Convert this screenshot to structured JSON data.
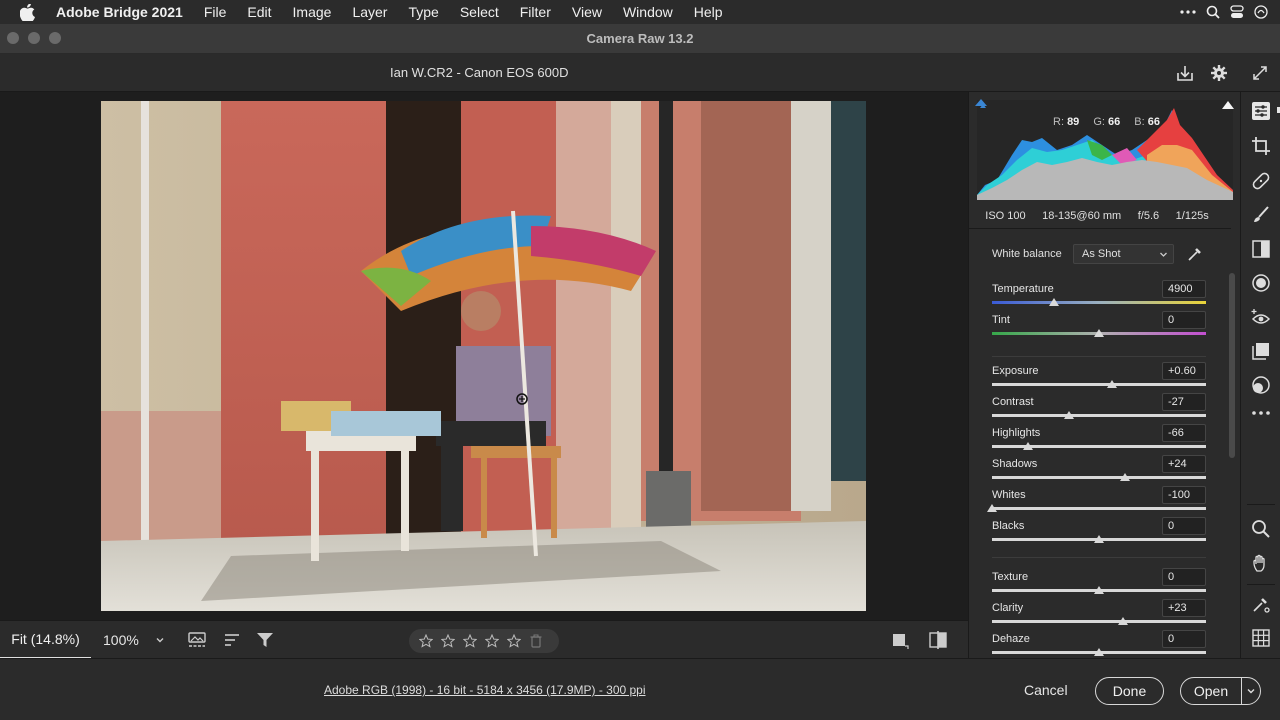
{
  "menubar": {
    "app_name": "Adobe Bridge 2021",
    "menus": [
      "File",
      "Edit",
      "Image",
      "Layer",
      "Type",
      "Select",
      "Filter",
      "View",
      "Window",
      "Help"
    ]
  },
  "window": {
    "title": "Camera Raw 13.2"
  },
  "file_info": "Ian W.CR2  -  Canon EOS 600D",
  "histogram": {
    "r_label": "R:",
    "r": "89",
    "g_label": "G:",
    "g": "66",
    "b_label": "B:",
    "b": "66"
  },
  "exif": {
    "iso": "ISO 100",
    "lens": "18-135@60 mm",
    "aperture": "f/5.6",
    "shutter": "1/125s"
  },
  "white_balance": {
    "label": "White balance",
    "value": "As Shot"
  },
  "sliders": [
    {
      "label": "Temperature",
      "value": "4900",
      "position": 0.29
    },
    {
      "label": "Tint",
      "value": "0",
      "position": 0.5
    },
    {
      "label": "Exposure",
      "value": "+0.60",
      "position": 0.56
    },
    {
      "label": "Contrast",
      "value": "-27",
      "position": 0.36
    },
    {
      "label": "Highlights",
      "value": "-66",
      "position": 0.17
    },
    {
      "label": "Shadows",
      "value": "+24",
      "position": 0.62
    },
    {
      "label": "Whites",
      "value": "-100",
      "position": 0.0
    },
    {
      "label": "Blacks",
      "value": "0",
      "position": 0.5
    },
    {
      "label": "Texture",
      "value": "0",
      "position": 0.5
    },
    {
      "label": "Clarity",
      "value": "+23",
      "position": 0.61
    },
    {
      "label": "Dehaze",
      "value": "0",
      "position": 0.5
    }
  ],
  "bottom": {
    "fit": "Fit (14.8%)",
    "zoom": "100%"
  },
  "footer": {
    "workflow": "Adobe RGB (1998) - 16 bit - 5184 x 3456 (17.9MP) - 300 ppi",
    "cancel": "Cancel",
    "done": "Done",
    "open": "Open"
  },
  "colors": {
    "accent": "#3a86d4",
    "panel_bg": "#2b2b2b",
    "canvas_bg": "#1e1e1e"
  }
}
